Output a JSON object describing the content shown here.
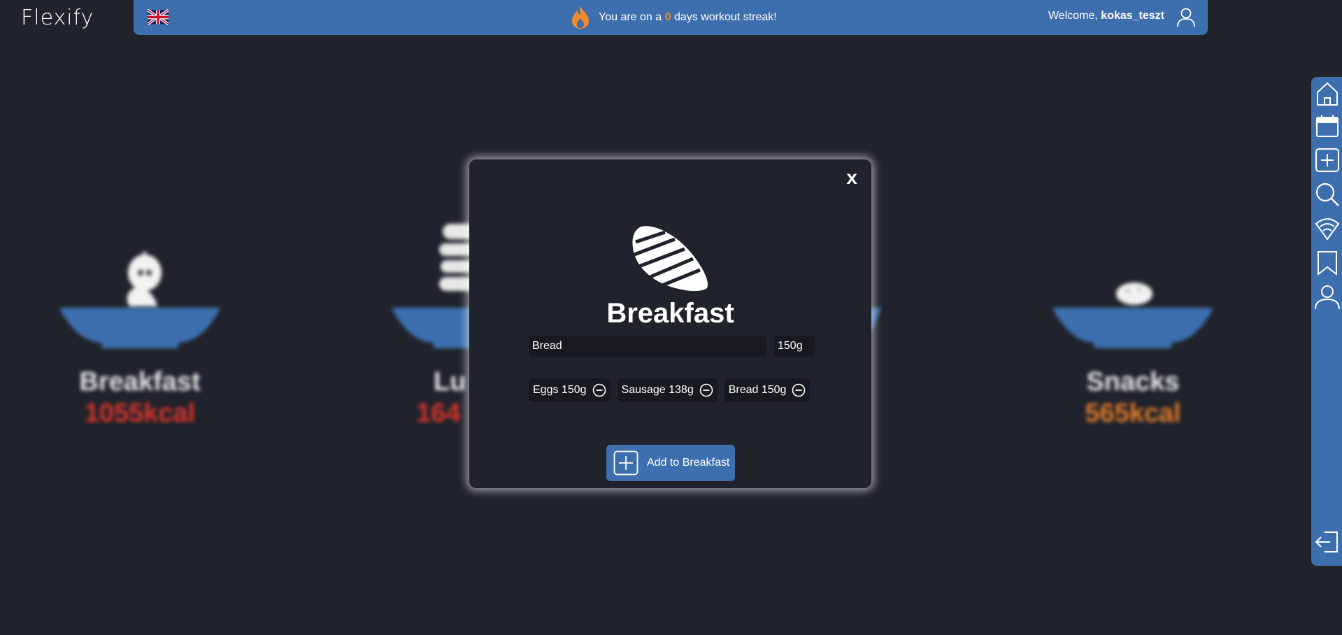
{
  "app": {
    "logo": "Flexify"
  },
  "header": {
    "language_icon": "uk-flag-icon",
    "streak_prefix": "You are on a",
    "streak_count": "0",
    "streak_suffix": "days workout streak!",
    "welcome_prefix": "Welcome,",
    "username": "kokas_teszt"
  },
  "sidebar": {
    "items": [
      {
        "icon": "home-icon"
      },
      {
        "icon": "calendar-icon"
      },
      {
        "icon": "add-icon"
      },
      {
        "icon": "search-icon"
      },
      {
        "icon": "feed-icon"
      },
      {
        "icon": "bookmark-icon"
      },
      {
        "icon": "profile-icon"
      },
      {
        "icon": "logout-icon"
      }
    ]
  },
  "meals": [
    {
      "title": "Breakfast",
      "kcal": "1055kcal",
      "color": "#d9342b"
    },
    {
      "title": "Lu",
      "kcal": "164",
      "color": "#d9342b"
    },
    {
      "title": "Snacks",
      "kcal": "565kcal",
      "color": "#e07b2a"
    }
  ],
  "modal": {
    "close_label": "x",
    "title": "Breakfast",
    "food_input_value": "Bread",
    "grams_input_value": "150g",
    "items": [
      {
        "label": "Eggs 150g"
      },
      {
        "label": "Sausage 138g"
      },
      {
        "label": "Bread 150g"
      }
    ],
    "add_button_label": "Add to Breakfast"
  },
  "colors": {
    "accent": "#3d6fae",
    "background": "#20232b",
    "streak": "#f08a2c"
  }
}
